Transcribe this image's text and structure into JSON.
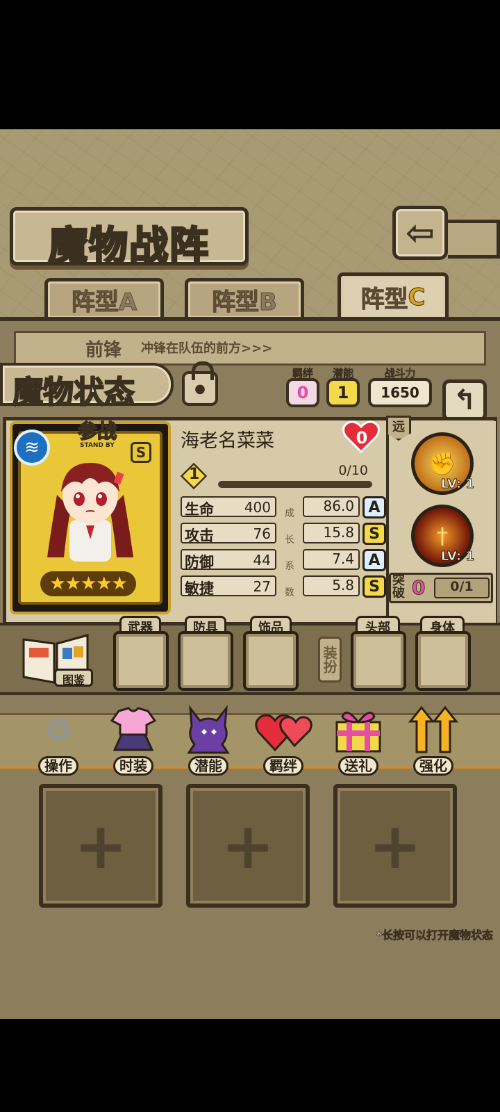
{
  "header": {
    "title": "魔物战阵",
    "back_icon": "back-arrow-icon"
  },
  "tabs": [
    {
      "label": "阵型A"
    },
    {
      "label": "阵型B"
    },
    {
      "label_main": "阵型",
      "label_letter": "C",
      "active": true
    }
  ],
  "formation": {
    "row_label": "前锋",
    "row_desc": "冲锋在队伍的前方>>>"
  },
  "status_panel": {
    "title": "魔物状态",
    "bond": {
      "label": "羁绊",
      "value": "0"
    },
    "potential": {
      "label": "潜能",
      "value": "1"
    },
    "power": {
      "label": "战斗力",
      "value": "1650"
    },
    "return_icon": "return-arrow-icon"
  },
  "card": {
    "badge": "参战",
    "badge_sub": "STAND BY",
    "rank": "S",
    "element_icon": "water-icon",
    "stars": "★★★★★"
  },
  "monster": {
    "name": "海老名菜菜",
    "affection": "0",
    "level": "1",
    "exp": "0/10",
    "exp_progress": 0,
    "stats": [
      {
        "label": "生命",
        "value": "400",
        "growth": "86.0",
        "grade": "A"
      },
      {
        "label": "攻击",
        "value": "76",
        "growth": "15.8",
        "grade": "S"
      },
      {
        "label": "防御",
        "value": "44",
        "growth": "7.4",
        "grade": "A"
      },
      {
        "label": "敏捷",
        "value": "27",
        "growth": "5.8",
        "grade": "S"
      }
    ],
    "growth_label": [
      "成",
      "长",
      "系",
      "数"
    ]
  },
  "side": {
    "range": "远",
    "skill1_lv": "LV: 1",
    "skill2_lv": "LV: 1",
    "breakthrough_label": "突破",
    "breakthrough_value": "0",
    "breakthrough_progress": "0/1"
  },
  "equipment": {
    "book_label": "图鉴",
    "slots": [
      "武器",
      "防具",
      "饰品"
    ],
    "dress_label": "装扮",
    "dress_slots": [
      "头部",
      "身体"
    ]
  },
  "actions": [
    {
      "label": "操作",
      "icon": "gear-icon"
    },
    {
      "label": "时装",
      "icon": "outfit-icon"
    },
    {
      "label": "潜能",
      "icon": "demon-icon"
    },
    {
      "label": "羁绊",
      "icon": "hearts-icon"
    },
    {
      "label": "送礼",
      "icon": "gift-icon"
    },
    {
      "label": "强化",
      "icon": "upgrade-arrows-icon"
    }
  ],
  "empty_slots": [
    "+",
    "+",
    "+"
  ],
  "hint": "*长按可以打开魔物状态",
  "colors": {
    "accent_gold": "#e9c738",
    "frame_dark": "#3b2f1f",
    "heart_red": "#e52c3a",
    "badge_pink": "#e64ea0"
  }
}
